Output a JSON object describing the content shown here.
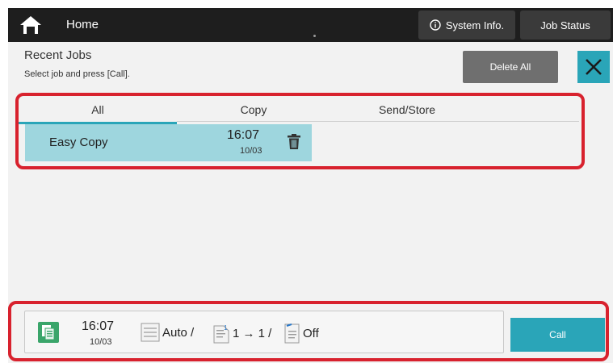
{
  "topbar": {
    "home_label": "Home",
    "system_info_label": "System Info.",
    "job_status_label": "Job Status",
    "color": "#1e1e1e"
  },
  "header": {
    "title": "Recent Jobs",
    "subtitle": "Select job and press [Call].",
    "delete_all_label": "Delete All"
  },
  "tabs": [
    {
      "label": "All",
      "active": true
    },
    {
      "label": "Copy",
      "active": false
    },
    {
      "label": "Send/Store",
      "active": false
    }
  ],
  "jobs": [
    {
      "name": "Easy Copy",
      "time": "16:07",
      "date": "10/03"
    }
  ],
  "selected_job": {
    "time": "16:07",
    "date": "10/03",
    "paper": "Auto /",
    "duplex": "1 → 1 /",
    "staple": "Off"
  },
  "call_label": "Call",
  "colors": {
    "accent": "#2aa5b8",
    "highlight": "#d8222e",
    "selected_row": "#9ed6de",
    "button_gray": "#6f6f6f"
  },
  "icons": [
    "home-icon",
    "info-icon",
    "close-icon",
    "trash-icon",
    "copy-mode-icon",
    "paper-tray-icon",
    "duplex-icon",
    "staple-icon"
  ]
}
